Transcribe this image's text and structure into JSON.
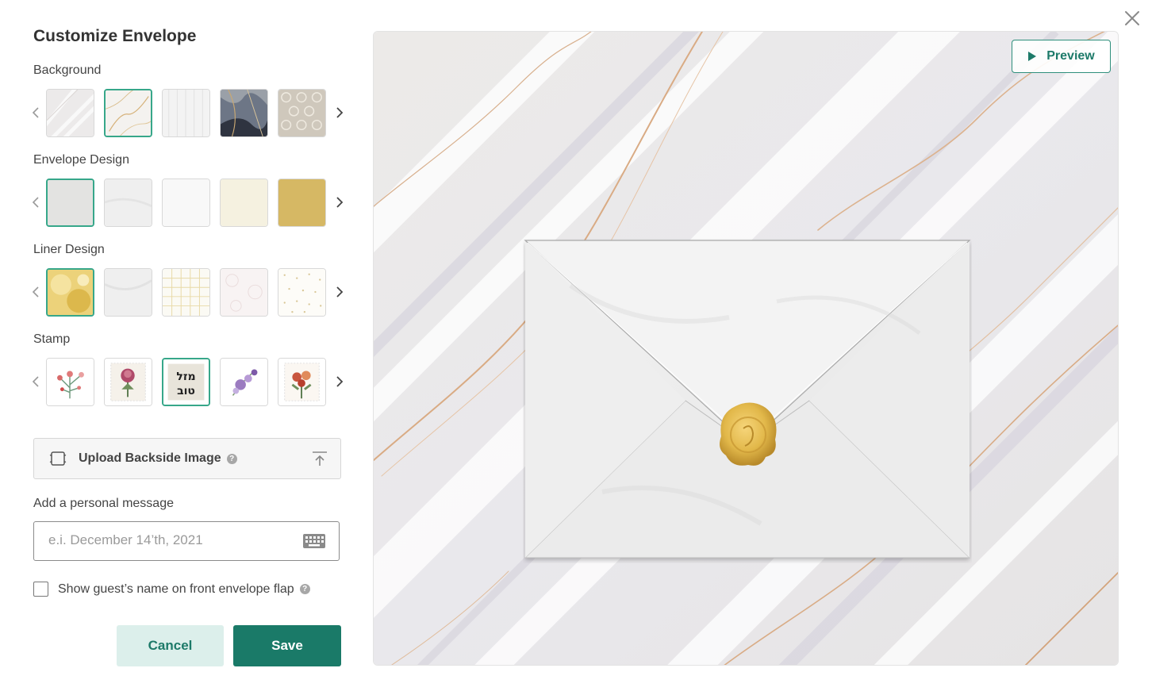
{
  "dialog": {
    "title": "Customize Envelope",
    "close_icon": "close-icon"
  },
  "sections": {
    "background": {
      "label": "Background",
      "selected_index": 1,
      "swatch_count": 5
    },
    "envelope_design": {
      "label": "Envelope Design",
      "selected_index": 0,
      "swatch_count": 5
    },
    "liner_design": {
      "label": "Liner Design",
      "selected_index": 0,
      "swatch_count": 5
    },
    "stamp": {
      "label": "Stamp",
      "selected_index": 2,
      "swatch_count": 5,
      "selected_stamp_text": "מזל טוב"
    }
  },
  "upload": {
    "label": "Upload Backside Image",
    "help": "?"
  },
  "message": {
    "label": "Add a personal message",
    "value": "",
    "placeholder": "e.i. December 14’th, 2021"
  },
  "guest_name": {
    "label": "Show guest’s name on front envelope flap",
    "checked": false,
    "help": "?"
  },
  "buttons": {
    "cancel": "Cancel",
    "save": "Save"
  },
  "preview": {
    "button_label": "Preview"
  },
  "colors": {
    "accent": "#1a7a68",
    "accent_light": "#dcefeb",
    "selected_border": "#37a78a"
  }
}
